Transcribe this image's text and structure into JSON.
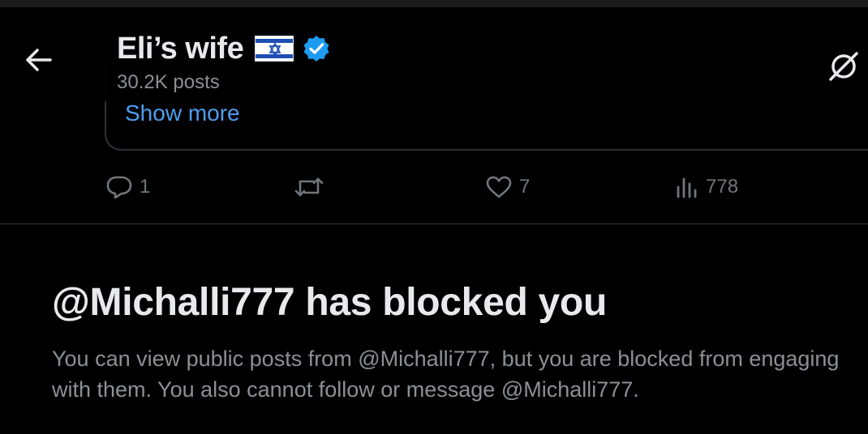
{
  "header": {
    "profile_name": "Eli’s wife",
    "post_count": "30.2K posts",
    "icons": {
      "back": "arrow-left-icon",
      "flag": "israel-flag-icon",
      "verified": "verified-badge-icon",
      "right": "cast-icon"
    },
    "verified_color": "#1d9bf0"
  },
  "quoted_post": {
    "show_more_label": "Show more",
    "link_color": "#4d9ef0"
  },
  "actions": {
    "reply_count": "1",
    "repost_count": "",
    "like_count": "7",
    "views_count": "778",
    "icons": [
      "reply-icon",
      "repost-icon",
      "like-icon",
      "views-icon"
    ]
  },
  "blocked": {
    "title": "@Michalli777 has blocked you",
    "description": "You can view public posts from @Michalli777, but you are blocked from engaging with them. You also cannot follow or message @Michalli777."
  }
}
